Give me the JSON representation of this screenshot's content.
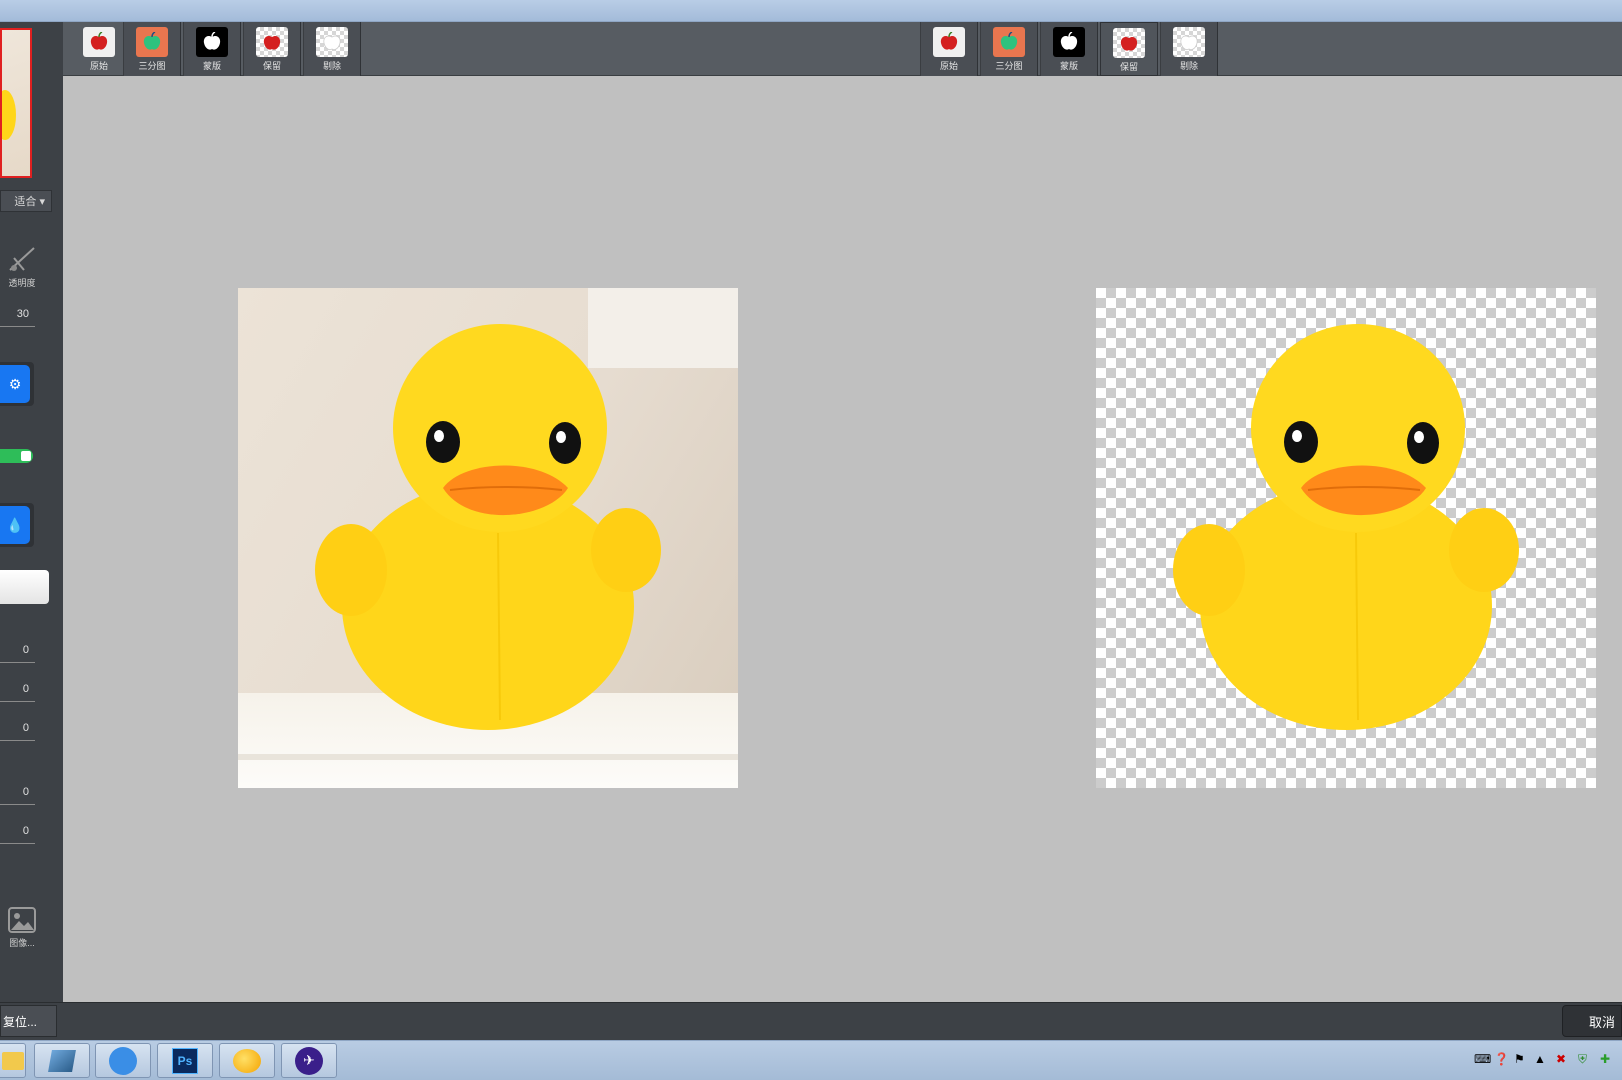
{
  "toolbar_left": [
    {
      "label": "原始",
      "icon": "apple-red-icon",
      "style": "light"
    },
    {
      "label": "三分图",
      "icon": "apple-green-icon",
      "style": "orange"
    },
    {
      "label": "蒙版",
      "icon": "apple-white-icon",
      "style": "black"
    },
    {
      "label": "保留",
      "icon": "apple-red-checker-icon",
      "style": "checker"
    },
    {
      "label": "剔除",
      "icon": "apple-blank-checker-icon",
      "style": "light"
    }
  ],
  "toolbar_right": [
    {
      "label": "原始",
      "icon": "apple-red-icon",
      "style": "light"
    },
    {
      "label": "三分图",
      "icon": "apple-green-icon",
      "style": "orange"
    },
    {
      "label": "蒙版",
      "icon": "apple-white-icon",
      "style": "black"
    },
    {
      "label": "保留",
      "icon": "apple-red-checker-icon",
      "style": "checker"
    },
    {
      "label": "剔除",
      "icon": "apple-blank-checker-icon",
      "style": "light"
    }
  ],
  "left_panel": {
    "fit_select": "适合 ▾",
    "transparency_label": "透明度",
    "transparency_value": "30",
    "numbers": [
      "0",
      "0",
      "0",
      "0",
      "0"
    ],
    "image_label": "图像..."
  },
  "status": {
    "left_button": "复位...",
    "cancel_button": "取消"
  },
  "colors": {
    "duck_yellow": "#ffd61a",
    "beak_orange": "#ff8a1a",
    "panel_dark": "#3d4146",
    "accent_blue": "#1877f2",
    "toggle_green": "#2ebd59"
  }
}
